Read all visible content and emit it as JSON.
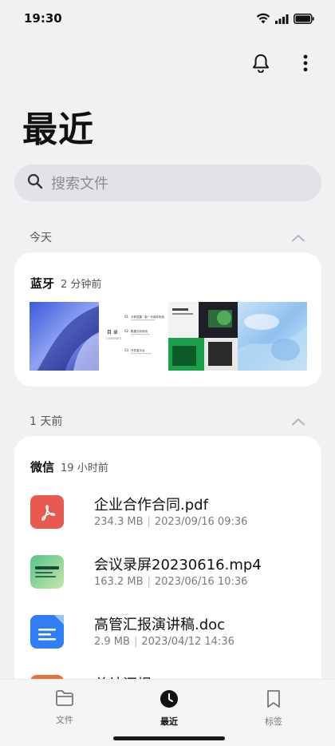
{
  "status": {
    "time": "19:30"
  },
  "header": {
    "title": "最近"
  },
  "search": {
    "placeholder": "搜索文件"
  },
  "sections": [
    {
      "title": "今天"
    },
    {
      "title": "1 天前"
    }
  ],
  "bluetooth_card": {
    "source": "蓝牙",
    "time": "2 分钟前",
    "thumbnails": [
      "blue-abstract-image",
      "contents-document-page",
      "dark-green-cards-image",
      "light-blue-abstract-image"
    ],
    "doc_thumb": {
      "heading": "目  录",
      "sub": "CONTENTS",
      "items": [
        {
          "num": "01",
          "text": "万和发展 · 新一代商务系统"
        },
        {
          "num": "02",
          "text": "数据分析系统"
        },
        {
          "num": "03",
          "text": "开发者平台"
        }
      ]
    }
  },
  "wechat_card": {
    "source": "微信",
    "time": "19 小时前",
    "files": [
      {
        "name": "企业合作合同.pdf",
        "size": "234.3 MB",
        "date": "2023/09/16 09:36",
        "icon": "pdf-icon",
        "color": "#e85a4f"
      },
      {
        "name": "会议录屏20230616.mp4",
        "size": "163.2 MB",
        "date": "2023/06/16 10:36",
        "icon": "video-thumbnail",
        "color": "#3ea36b"
      },
      {
        "name": "高管汇报演讲稿.doc",
        "size": "2.9 MB",
        "date": "2023/04/12 14:36",
        "icon": "doc-icon",
        "color": "#2f7ef5"
      },
      {
        "name": "总结汇报.ppt",
        "icon": "ppt-icon",
        "color": "#e8703a"
      }
    ]
  },
  "nav": {
    "items": [
      {
        "label": "文件",
        "icon": "folder-icon"
      },
      {
        "label": "最近",
        "icon": "clock-icon",
        "active": true
      },
      {
        "label": "标签",
        "icon": "bookmark-icon"
      }
    ]
  }
}
